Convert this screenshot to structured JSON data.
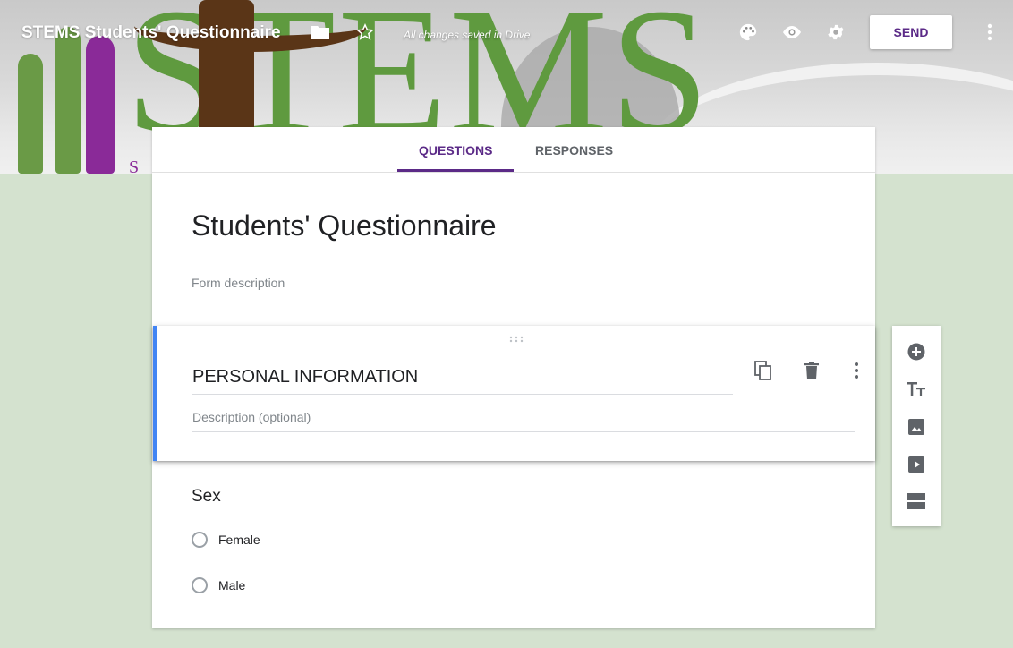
{
  "app": {
    "title": "STEMS Students' Questionnaire",
    "saved_status": "All changes saved in Drive",
    "send_label": "SEND"
  },
  "banner": {
    "letters": "STEMS",
    "small_text": "S"
  },
  "tabs": [
    {
      "label": "QUESTIONS",
      "active": true
    },
    {
      "label": "RESPONSES",
      "active": false
    }
  ],
  "form": {
    "title": "Students' Questionnaire",
    "description_placeholder": "Form description"
  },
  "section": {
    "title": "PERSONAL INFORMATION",
    "description_placeholder": "Description (optional)"
  },
  "question": {
    "title": "Sex",
    "options": [
      "Female",
      "Male"
    ]
  },
  "colors": {
    "accent": "#5b2a87",
    "section_border": "#4285f4",
    "background": "#d4e2cf"
  },
  "icons": {
    "topbar": [
      "folder-icon",
      "star-icon",
      "palette-icon",
      "eye-icon",
      "gear-icon",
      "more-vert-icon"
    ],
    "section": [
      "duplicate-icon",
      "delete-icon",
      "more-vert-icon"
    ],
    "sidebar": [
      "add-question-icon",
      "add-title-icon",
      "add-image-icon",
      "add-video-icon",
      "add-section-icon"
    ]
  }
}
